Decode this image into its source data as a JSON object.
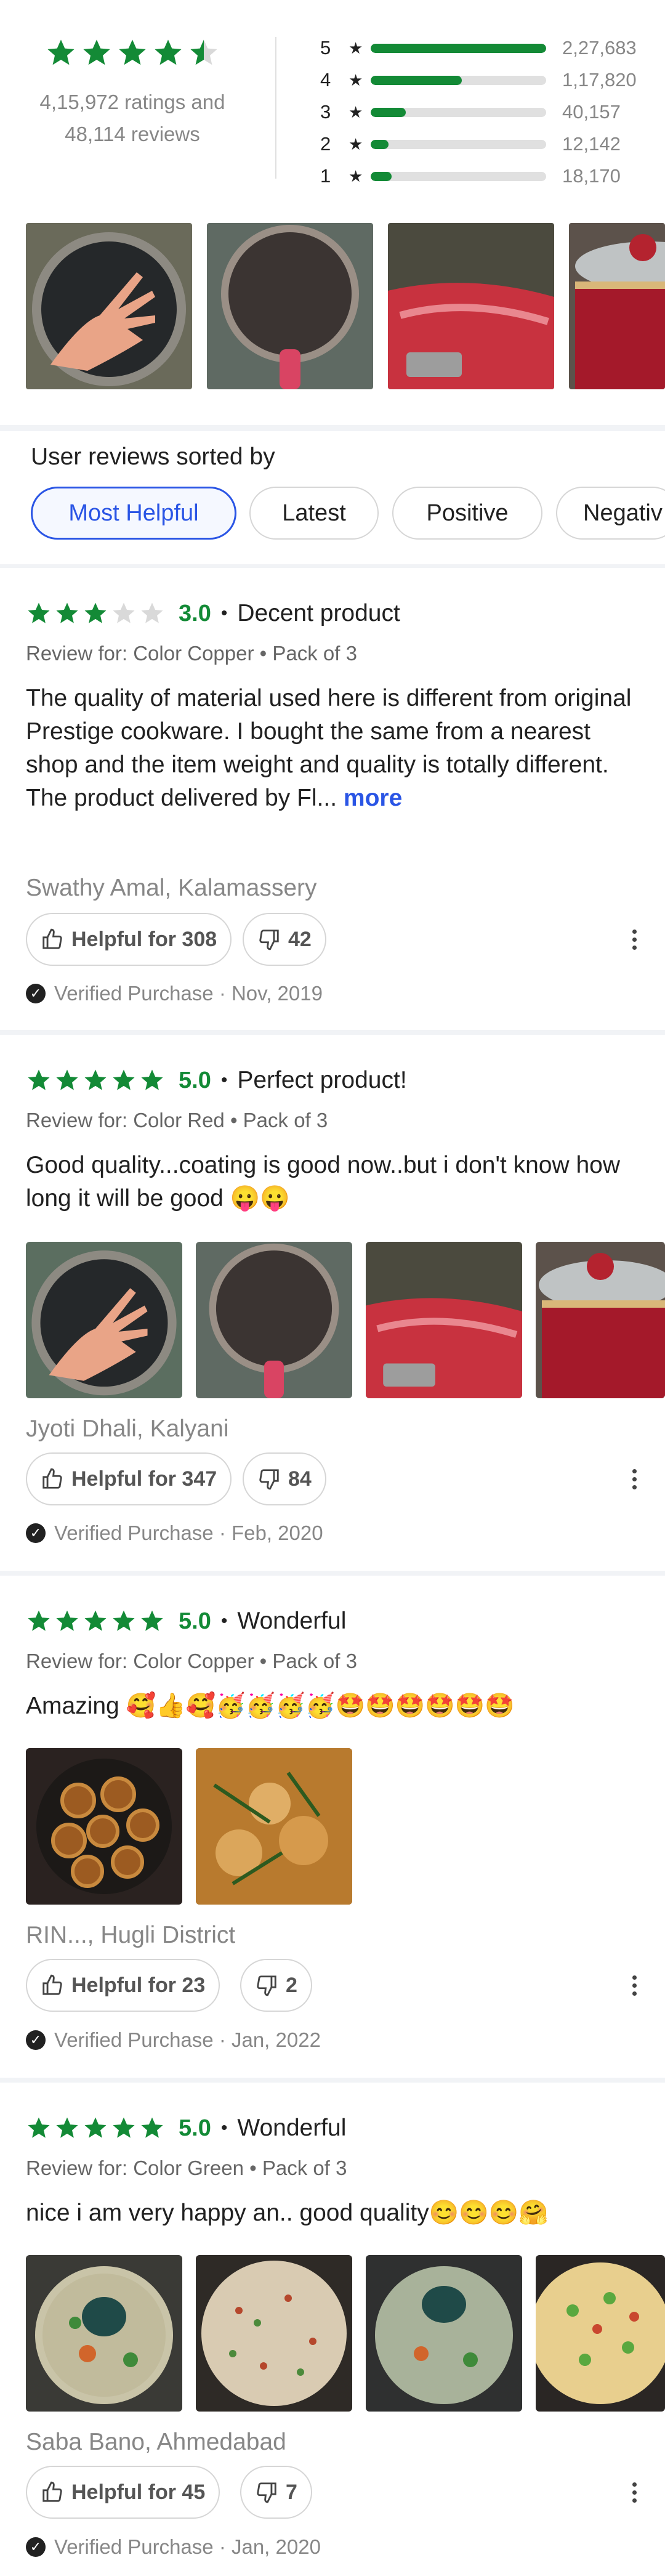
{
  "summary": {
    "stars": 4.5,
    "ratings_text": "4,15,972 ratings and",
    "reviews_text": "48,114 reviews",
    "bars": [
      {
        "label": "5",
        "count": "2,27,683",
        "fraction": 1.0,
        "color": "#138a36"
      },
      {
        "label": "4",
        "count": "1,17,820",
        "fraction": 0.52,
        "color": "#138a36"
      },
      {
        "label": "3",
        "count": "40,157",
        "fraction": 0.2,
        "color": "#138a36"
      },
      {
        "label": "2",
        "count": "12,142",
        "fraction": 0.1,
        "color": "#138a36"
      },
      {
        "label": "1",
        "count": "18,170",
        "fraction": 0.12,
        "color": "#138a36"
      }
    ]
  },
  "sort": {
    "title": "User reviews sorted by",
    "chips": [
      "Most Helpful",
      "Latest",
      "Positive",
      "Negativ"
    ]
  },
  "reviews": [
    {
      "stars": 3,
      "rating": "3.0",
      "title": "Decent product",
      "review_for": "Review for: Color Copper • Pack of 3",
      "text": "The quality of material used here is different from original Prestige cookware. I bought the same from a nearest shop and the item weight and quality is totally different.",
      "text2": "The product delivered by Fl...",
      "more": "more",
      "author": "Swathy Amal, Kalamassery",
      "helpful": "Helpful for 308",
      "dislikes": "42",
      "verified": "Verified Purchase · Nov, 2019"
    },
    {
      "stars": 5,
      "rating": "5.0",
      "title": "Perfect product!",
      "review_for": "Review for: Color Red • Pack of 3",
      "text": "Good quality...coating is good now..but i don't know how long it will be good 😛😛",
      "author": "Jyoti  Dhali, Kalyani",
      "helpful": "Helpful for 347",
      "dislikes": "84",
      "verified": "Verified Purchase · Feb, 2020"
    },
    {
      "stars": 5,
      "rating": "5.0",
      "title": "Wonderful",
      "review_for": "Review for: Color Copper • Pack of 3",
      "text": "Amazing 🥰👍🥰🥳🥳🥳🥳🤩🤩🤩🤩🤩🤩",
      "author": "RIN..., Hugli District",
      "helpful": "Helpful for 23",
      "dislikes": "2",
      "verified": "Verified Purchase · Jan, 2022"
    },
    {
      "stars": 5,
      "rating": "5.0",
      "title": "Wonderful",
      "review_for": "Review for: Color Green • Pack of 3",
      "text": "nice i am very happy an.. good quality😊😊😊🤗",
      "author": "Saba  Bano, Ahmedabad",
      "helpful": "Helpful for 45",
      "dislikes": "7",
      "verified": "Verified Purchase · Jan, 2020"
    }
  ],
  "colors": {
    "star_green": "#138a36",
    "star_empty": "#d9d9d9",
    "accent": "#2a55e5"
  }
}
